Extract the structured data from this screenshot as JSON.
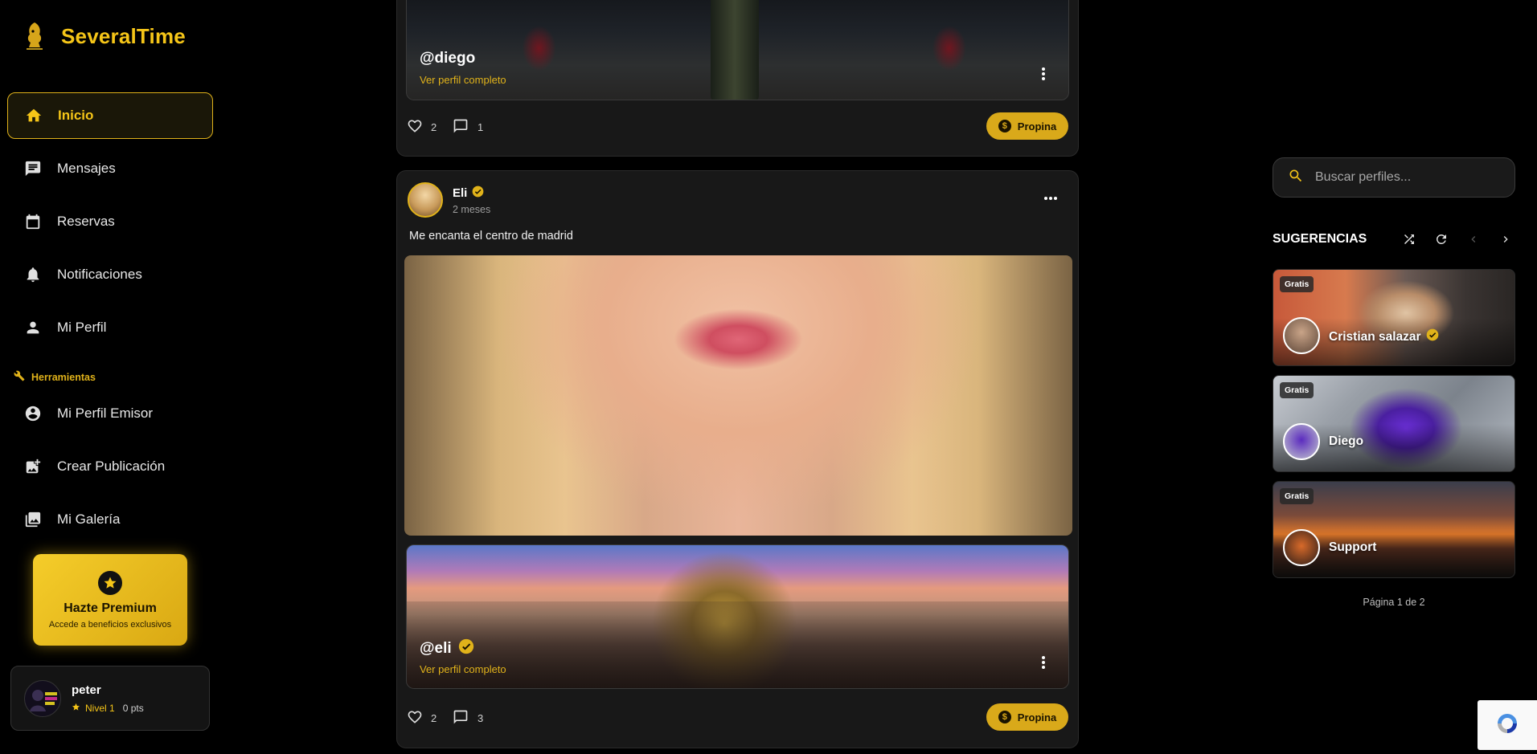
{
  "app": {
    "name": "SeveralTime"
  },
  "sidebar": {
    "nav": [
      {
        "label": "Inicio",
        "icon": "home-icon",
        "active": true
      },
      {
        "label": "Mensajes",
        "icon": "chat-icon"
      },
      {
        "label": "Reservas",
        "icon": "calendar-icon"
      },
      {
        "label": "Notificaciones",
        "icon": "bell-icon"
      },
      {
        "label": "Mi Perfil",
        "icon": "person-icon"
      }
    ],
    "tools_header": "Herramientas",
    "tools": [
      {
        "label": "Mi Perfil Emisor",
        "icon": "account-circle-icon"
      },
      {
        "label": "Crear Publicación",
        "icon": "add-photo-icon"
      },
      {
        "label": "Mi Galería",
        "icon": "gallery-icon"
      }
    ],
    "premium": {
      "title": "Hazte Premium",
      "subtitle": "Accede a beneficios exclusivos"
    },
    "user": {
      "name": "peter",
      "level": "Nivel 1",
      "points": "0 pts"
    }
  },
  "feed": {
    "posts": [
      {
        "promo": {
          "handle": "@diego",
          "link": "Ver perfil completo"
        },
        "likes": "2",
        "comments": "1",
        "tip_label": "Propina"
      },
      {
        "author": "Eli",
        "time": "2 meses",
        "text": "Me encanta el centro de madrid",
        "promo": {
          "handle": "@eli",
          "link": "Ver perfil completo"
        },
        "likes": "2",
        "comments": "3",
        "tip_label": "Propina"
      }
    ]
  },
  "search": {
    "placeholder": "Buscar perfiles..."
  },
  "suggestions": {
    "title": "SUGERENCIAS",
    "items": [
      {
        "badge": "Gratis",
        "name": "Cristian salazar",
        "verified": true
      },
      {
        "badge": "Gratis",
        "name": "Diego",
        "verified": false
      },
      {
        "badge": "Gratis",
        "name": "Support",
        "verified": false
      }
    ],
    "pagination": "Página 1 de 2"
  },
  "colors": {
    "accent": "#f5c518",
    "background": "#000000",
    "card": "#181818"
  }
}
